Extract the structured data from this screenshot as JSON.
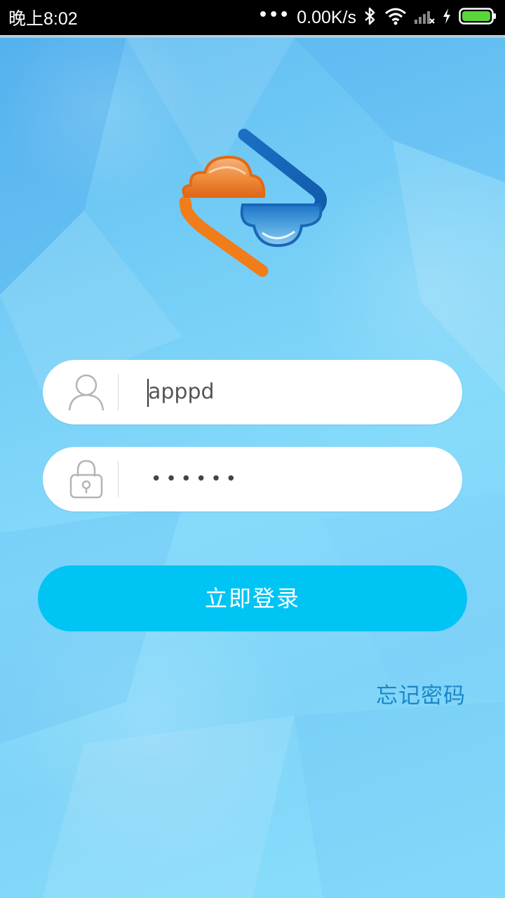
{
  "status_bar": {
    "time": "晚上8:02",
    "dots": "•••",
    "network_speed": "0.00K/s",
    "icons": [
      "bluetooth-icon",
      "wifi-icon",
      "cell-signal-icon",
      "charging-icon",
      "battery-icon"
    ]
  },
  "logo": {
    "icon": "cloud-sync-logo"
  },
  "username": {
    "value": "apppd",
    "icon": "user-icon"
  },
  "password": {
    "masked_value": "••••••",
    "icon": "lock-icon"
  },
  "login_button": {
    "label": "立即登录"
  },
  "forgot_password": {
    "label": "忘记密码"
  },
  "colors": {
    "accent_button": "#00c4f4",
    "link": "#1a86c8",
    "logo_orange": "#f07d1a",
    "logo_blue": "#1670c2"
  }
}
